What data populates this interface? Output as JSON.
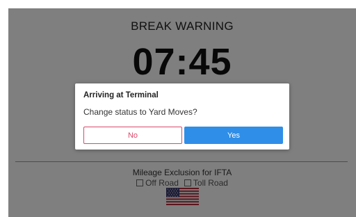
{
  "screen": {
    "warning_title": "BREAK WARNING",
    "timer": "07:45",
    "mileage": {
      "title": "Mileage Exclusion for IFTA",
      "options": [
        {
          "label": "Off Road",
          "checked": false
        },
        {
          "label": "Toll Road",
          "checked": false
        }
      ]
    },
    "flag_icon": "us-flag-icon"
  },
  "dialog": {
    "title": "Arriving at Terminal",
    "message": "Change status to Yard Moves?",
    "no_label": "No",
    "yes_label": "Yes"
  },
  "colors": {
    "overlay": "#808080",
    "no_button": "#d9486b",
    "yes_button": "#2f8ee8"
  }
}
